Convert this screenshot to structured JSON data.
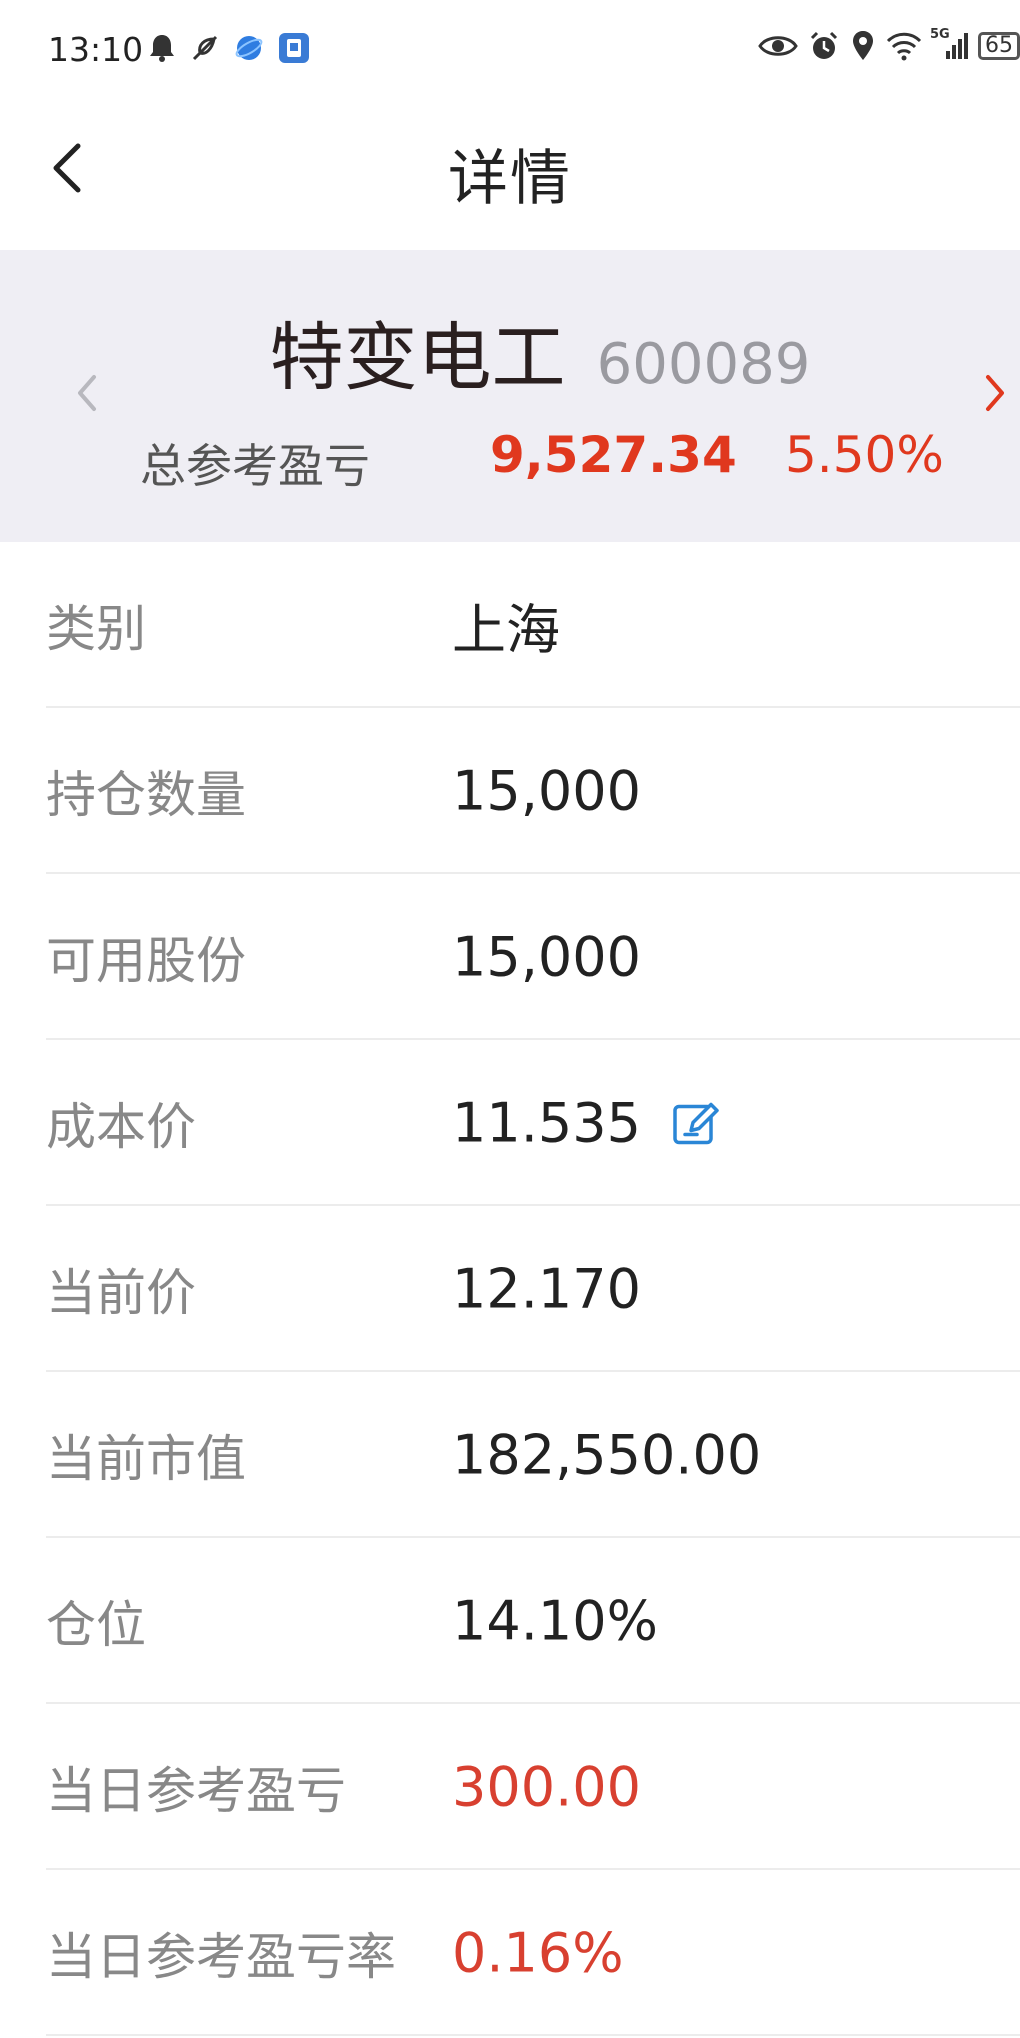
{
  "status_bar": {
    "time": "13:10",
    "left_icons": [
      "bell-icon",
      "leaf-icon",
      "globe-app-icon",
      "app-badge-icon"
    ],
    "right_icons": [
      "eye-icon",
      "alarm-icon",
      "location-icon",
      "wifi-icon",
      "5g-signal-icon",
      "battery-icon"
    ],
    "network_label": "5G",
    "battery_text": "65"
  },
  "nav": {
    "title": "详情",
    "back_icon": "chevron-left-icon"
  },
  "summary": {
    "stock_name": "特变电工",
    "stock_code": "600089",
    "pnl_label": "总参考盈亏",
    "pnl_value": "9,527.34",
    "pnl_pct": "5.50%",
    "prev_icon": "chevron-left-icon",
    "next_icon": "chevron-right-icon",
    "accent_color": "#e0381e"
  },
  "rows": [
    {
      "label": "类别",
      "value": "上海"
    },
    {
      "label": "持仓数量",
      "value": "15,000"
    },
    {
      "label": "可用股份",
      "value": "15,000"
    },
    {
      "label": "成本价",
      "value": "11.535",
      "icon": "edit-icon"
    },
    {
      "label": "当前价",
      "value": "12.170"
    },
    {
      "label": "当前市值",
      "value": "182,550.00"
    },
    {
      "label": "仓位",
      "value": "14.10%"
    },
    {
      "label": "当日参考盈亏",
      "value": "300.00",
      "color": "#d84030"
    },
    {
      "label": "当日参考盈亏率",
      "value": "0.16%",
      "color": "#d84030"
    }
  ]
}
